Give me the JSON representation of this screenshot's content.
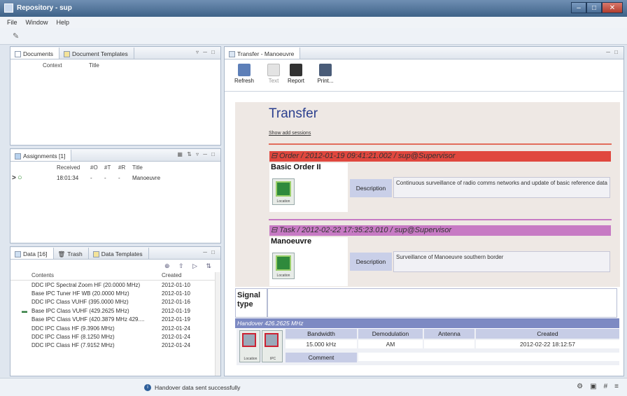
{
  "window": {
    "title": "Repository - sup"
  },
  "menu": [
    "File",
    "Window",
    "Help"
  ],
  "documents_panel": {
    "tabs": [
      "Documents",
      "Document Templates"
    ],
    "columns": [
      "Context",
      "Title"
    ]
  },
  "assignments_panel": {
    "tab": "Assignments [1]",
    "columns": [
      "Received",
      "#O",
      "#T",
      "#R",
      "Title"
    ],
    "rows": [
      {
        "marker": ">",
        "received": "18:01:34",
        "o": "-",
        "t": "-",
        "r": "-",
        "title": "Manoeuvre"
      }
    ]
  },
  "data_panel": {
    "tabs": [
      "Data [16]",
      "Trash",
      "Data Templates"
    ],
    "columns": [
      "Contents",
      "Created"
    ],
    "rows": [
      {
        "contents": "DDC IPC Spectral Zoom HF (20.0000 MHz)",
        "created": "2012-01-10"
      },
      {
        "contents": "Base IPC Tuner HF WB (20.0000 MHz)",
        "created": "2012-01-10"
      },
      {
        "contents": "DDC IPC Class VUHF (395.0000 MHz)",
        "created": "2012-01-16"
      },
      {
        "contents": "Base IPC Class VUHF (429.2625 MHz)",
        "created": "2012-01-19"
      },
      {
        "contents": "Base IPC Class VUHF (420.3879 MHz 429....",
        "created": "2012-01-19"
      },
      {
        "contents": "DDC IPC Class HF (9.3906 MHz)",
        "created": "2012-01-24"
      },
      {
        "contents": "DDC IPC Class HF (8.1250 MHz)",
        "created": "2012-01-24"
      },
      {
        "contents": "DDC IPC Class HF (7.9152 MHz)",
        "created": "2012-01-24"
      }
    ]
  },
  "editor": {
    "tab": "Transfer - Manoeuvre",
    "toolbar": [
      "Refresh",
      "Text",
      "Report",
      "Print..."
    ],
    "heading": "Transfer",
    "show_link": "Show add sessions",
    "order": {
      "header": "Order / 2012-01-19 09:41:21.002 / sup@Supervisor",
      "color": "#e0473e",
      "title": "Basic Order II",
      "desc_label": "Description",
      "desc": "Continuous surveillance of radio comms networks and update of basic reference data",
      "thumb_label": "Location"
    },
    "task": {
      "header": "Task / 2012-02-22 17:35:23.010 / sup@Supervisor",
      "color": "#c77ac4",
      "title": "Manoeuvre",
      "desc_label": "Description",
      "desc": "Surveillance of Manoeuvre southern border",
      "thumb_label": "Location"
    },
    "signal_type_label": "Signal type",
    "handover": {
      "title": "Handover 426.2625 MHz",
      "columns": [
        "Bandwidth",
        "Demodulation",
        "Antenna",
        "Created"
      ],
      "values": [
        "15.000 kHz",
        "AM",
        "",
        "2012-02-22 18:12:57"
      ],
      "comment_label": "Comment",
      "thumbs": [
        "Location",
        "IPC"
      ]
    }
  },
  "status": {
    "message": "Handover data sent successfully"
  }
}
